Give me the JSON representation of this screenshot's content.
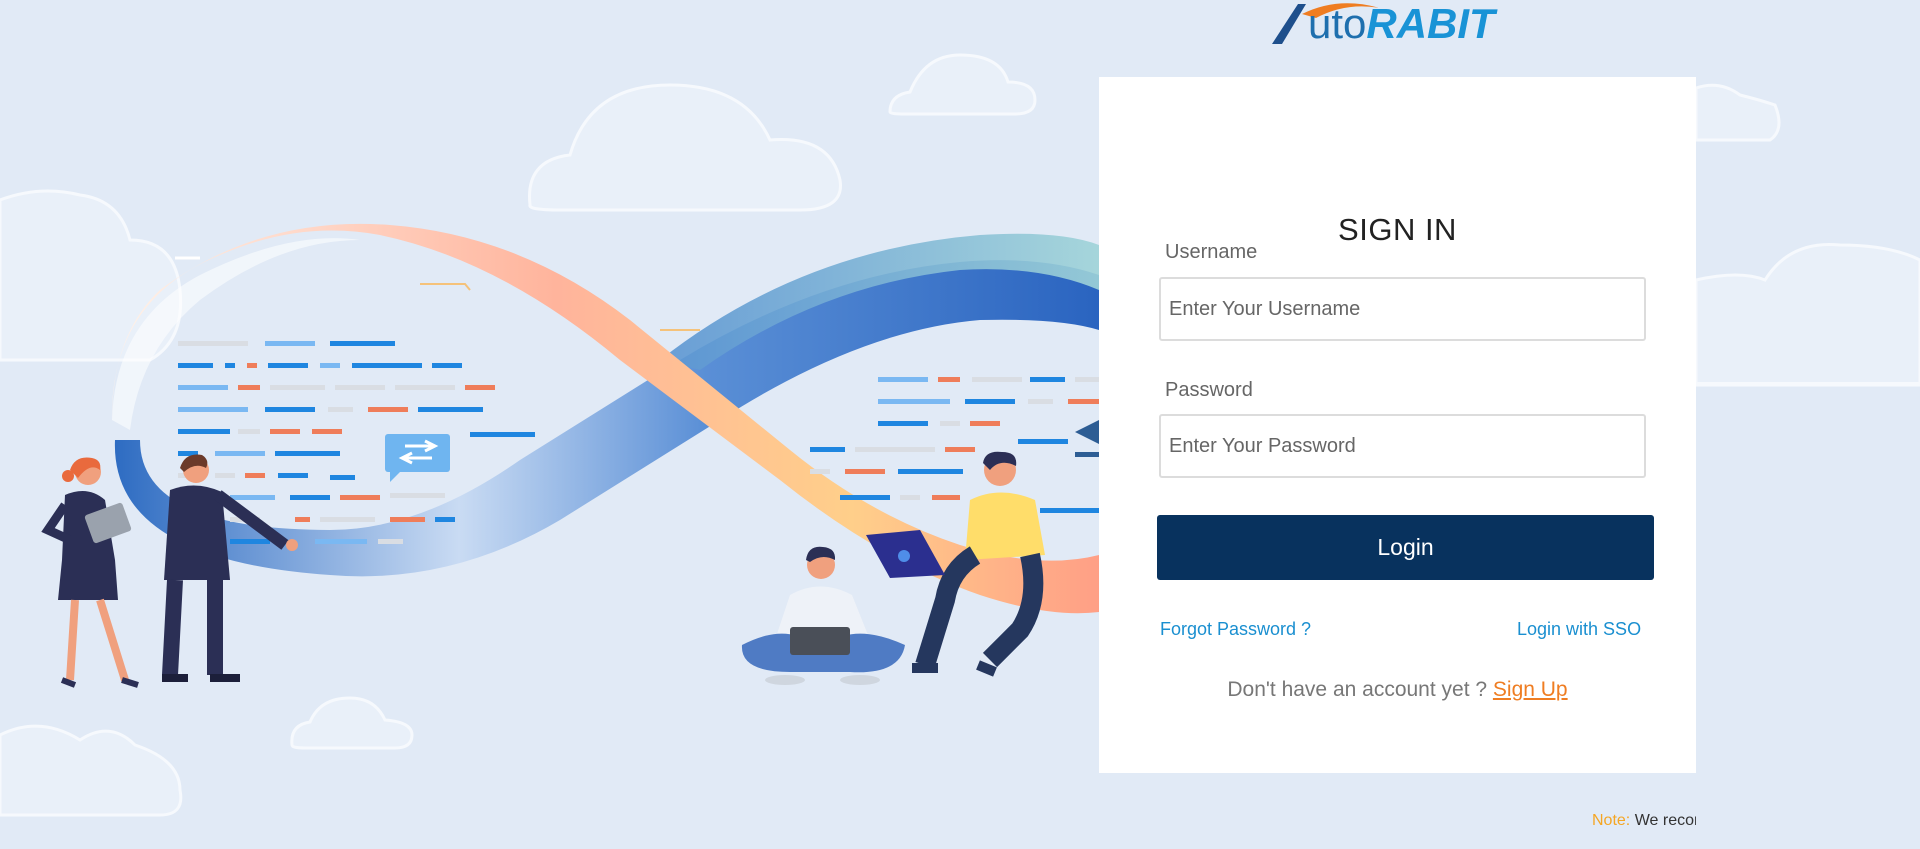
{
  "logo": {
    "text_auto": "utoRABIT",
    "prefix": "A",
    "brand_main": "uto",
    "brand_accent": "RABIT",
    "colors": {
      "blue": "#1e6fae",
      "accent_blue": "#1993d6",
      "orange": "#ef7d22"
    }
  },
  "login_card": {
    "title": "SIGN IN",
    "username": {
      "label": "Username",
      "placeholder": "Enter Your Username",
      "value": ""
    },
    "password": {
      "label": "Password",
      "placeholder": "Enter Your Password",
      "value": ""
    },
    "login_button": "Login",
    "forgot_password": "Forgot Password ?",
    "login_sso": "Login with SSO",
    "signup_prompt": "Don't have an account yet ?",
    "signup_link": "Sign Up"
  },
  "note": {
    "label": "Note:",
    "text": "We recor"
  },
  "colors": {
    "background": "#e1eaf6",
    "primary_button": "#08325e",
    "link": "#1a8fd0",
    "signup": "#ef7d22",
    "note_label": "#f5a623"
  }
}
